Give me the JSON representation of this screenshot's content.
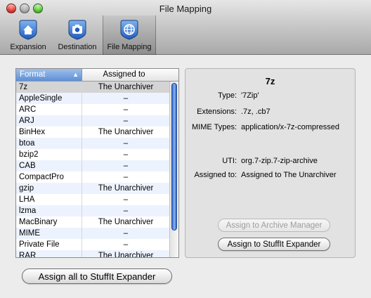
{
  "window": {
    "title": "File Mapping"
  },
  "toolbar": [
    {
      "label": "Expansion"
    },
    {
      "label": "Destination"
    },
    {
      "label": "File Mapping"
    }
  ],
  "list": {
    "columns": {
      "format": "Format",
      "assigned": "Assigned to"
    },
    "sort_indicator": "▲",
    "rows": [
      {
        "format": "7z",
        "assigned": "The Unarchiver"
      },
      {
        "format": "AppleSingle",
        "assigned": "–"
      },
      {
        "format": "ARC",
        "assigned": "–"
      },
      {
        "format": "ARJ",
        "assigned": "–"
      },
      {
        "format": "BinHex",
        "assigned": "The Unarchiver"
      },
      {
        "format": "btoa",
        "assigned": "–"
      },
      {
        "format": "bzip2",
        "assigned": "–"
      },
      {
        "format": "CAB",
        "assigned": "–"
      },
      {
        "format": "CompactPro",
        "assigned": "–"
      },
      {
        "format": "gzip",
        "assigned": "The Unarchiver"
      },
      {
        "format": "LHA",
        "assigned": "–"
      },
      {
        "format": "lzma",
        "assigned": "–"
      },
      {
        "format": "MacBinary",
        "assigned": "The Unarchiver"
      },
      {
        "format": "MIME",
        "assigned": "–"
      },
      {
        "format": "Private File",
        "assigned": "–"
      },
      {
        "format": "RAR",
        "assigned": "The Unarchiver"
      }
    ]
  },
  "detail": {
    "title": "7z",
    "type_label": "Type:",
    "type_value": "'7Zip'",
    "extensions_label": "Extensions:",
    "extensions_value": ".7z, .cb7",
    "mime_label": "MIME Types:",
    "mime_value": "application/x-7z-compressed",
    "uti_label": "UTI:",
    "uti_value": "org.7-zip.7-zip-archive",
    "assigned_label": "Assigned to:",
    "assigned_value": "Assigned to The Unarchiver",
    "btn_archive_manager": "Assign to Archive Manager",
    "btn_stuffit": "Assign to StuffIt Expander"
  },
  "footer": {
    "btn_assign_all": "Assign all to StuffIt Expander"
  },
  "colors": {
    "accent": "#5d8fd7",
    "scroll_thumb": "#2d63c7",
    "alt_row": "#edf3fe",
    "selected_row": "#d4d4d4"
  },
  "icons": [
    "house-icon",
    "camera-icon",
    "globe-icon"
  ]
}
